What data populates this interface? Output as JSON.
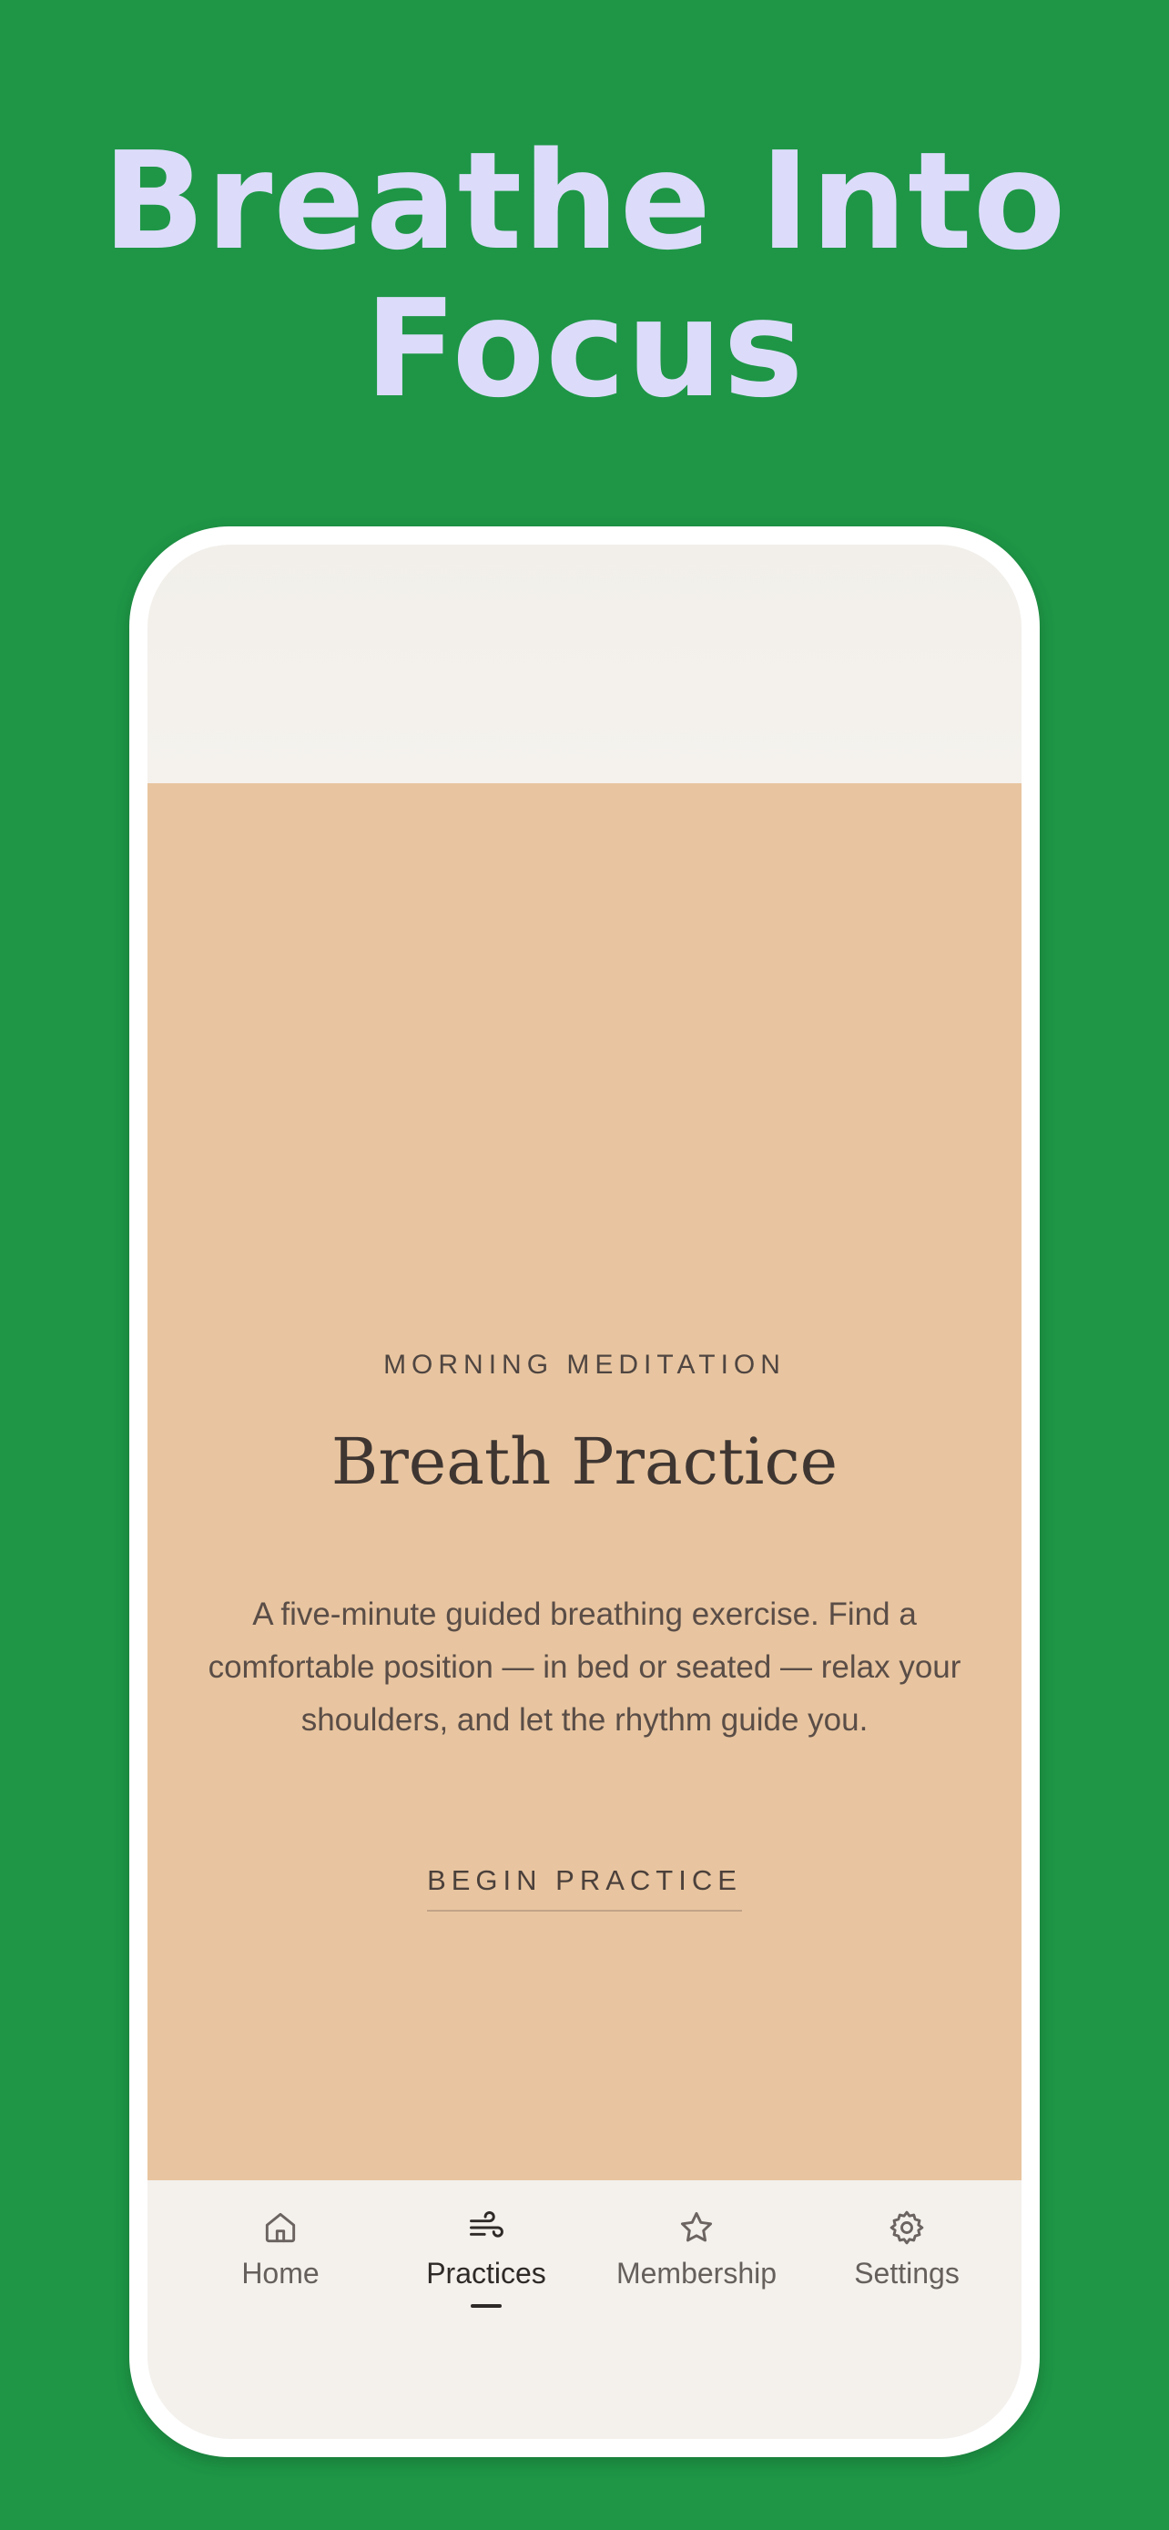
{
  "headline": {
    "line1": "Breathe Into",
    "line2": "Focus"
  },
  "card": {
    "kicker": "MORNING MEDITATION",
    "title": "Breath Practice",
    "description": "A five-minute guided breathing exercise. Find a comfortable position — in bed or seated — relax your shoulders, and let the rhythm guide you.",
    "cta_label": "BEGIN PRACTICE",
    "background_color": "#e8c5a0"
  },
  "tabbar": {
    "active_tab": "Practices",
    "tabs": [
      {
        "label": "Home",
        "icon": "home-icon"
      },
      {
        "label": "Practices",
        "icon": "wind-icon"
      },
      {
        "label": "Membership",
        "icon": "star-icon"
      },
      {
        "label": "Settings",
        "icon": "gear-icon"
      }
    ]
  },
  "colors": {
    "page_background": "#1e9646",
    "headline": "#dcdcfa"
  }
}
